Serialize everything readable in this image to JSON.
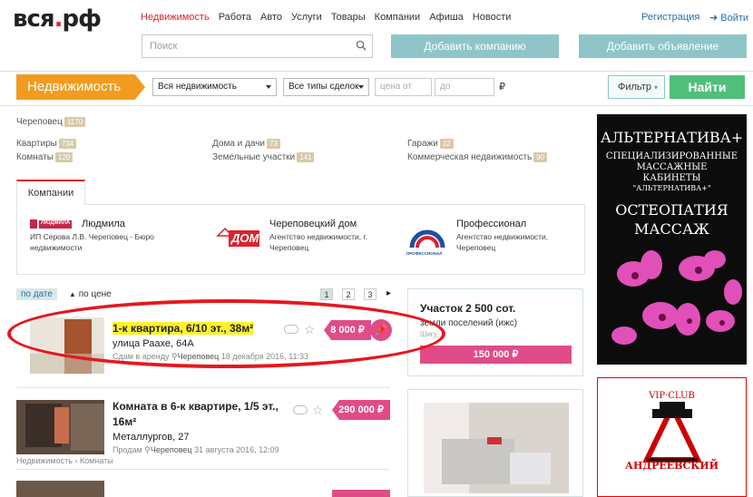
{
  "header": {
    "logo_main": "вся",
    "logo_dot": ".",
    "logo_tail": "рф",
    "nav": [
      "Недвижимость",
      "Работа",
      "Авто",
      "Услуги",
      "Товары",
      "Компании",
      "Афиша",
      "Новости"
    ],
    "register": "Регистрация",
    "login": "Войти",
    "search_placeholder": "Поиск",
    "add_company": "Добавить компанию",
    "add_listing": "Добавить объявление"
  },
  "filter": {
    "section": "Недвижимость",
    "type_select": "Вся недвижимость",
    "deal_select": "Все типы сделок",
    "price_from": "цена от",
    "price_to": "до",
    "currency": "₽",
    "filter_btn": "Фильтр",
    "find_btn": "Найти"
  },
  "city": {
    "name": "Череповец",
    "count": "1170"
  },
  "categories": [
    {
      "label": "Квартиры",
      "count": "734"
    },
    {
      "label": "Комнаты",
      "count": "120"
    },
    {
      "label": "Дома и дачи",
      "count": "73"
    },
    {
      "label": "Земельные участки",
      "count": "141"
    },
    {
      "label": "Гаражи",
      "count": "12"
    },
    {
      "label": "Коммерческая недвижимость",
      "count": "90"
    }
  ],
  "companies": {
    "tab": "Компании",
    "items": [
      {
        "logo_text": "ЛЮДМИЛА",
        "name": "Людмила",
        "desc": "ИП Серова Л.В. Череповец - Бюро недвижимости"
      },
      {
        "logo_text": "ДОМ",
        "name": "Череповецкий дом",
        "desc": "Агентство недвижимости, г. Череповец"
      },
      {
        "logo_text": "ПРОФЕССИОНАЛ",
        "name": "Профессионал",
        "desc": "Агентство недвижимости, Череповец"
      }
    ]
  },
  "sort": {
    "by_date": "по дате",
    "by_price": "по цене",
    "pages": [
      "1",
      "2",
      "3"
    ],
    "next": "▸"
  },
  "listings": [
    {
      "title": "1-к квартира, 6/10 эт., 38м²",
      "address": "улица Раахе, 64А",
      "deal": "Сдам в аренду",
      "city": "Череповец",
      "date": "18 декабря 2016, 11:33",
      "price": "8 000 ₽"
    },
    {
      "title_line1": "Комната в 6-к квартире, 1/5 эт.,",
      "title_line2": "16м²",
      "address": "Металлургов, 27",
      "deal": "Продам",
      "city": "Череповец",
      "date": "31 августа 2016, 12:09",
      "price": "290 000 ₽"
    }
  ],
  "breadcrumb": [
    "Недвижимость",
    "Комнаты"
  ],
  "promo": {
    "title": "Участок 2 500 сот.",
    "subtitle": "земли поселений (ижс)",
    "place": "Шигу",
    "price": "150 000 ₽"
  },
  "ad1": {
    "l1": "АЛЬТЕРНАТИВА+",
    "l2": "СПЕЦИАЛИЗИРОВАННЫЕ",
    "l3": "МАССАЖНЫЕ",
    "l4": "КАБИНЕТЫ",
    "l5": "\"АЛЬТЕРНАТИВА+\"",
    "l6": "ОСТЕОПАТИЯ",
    "l7": "МАССАЖ"
  },
  "ad2": {
    "top": "VIP·CLUB",
    "bottom": "АНДРЕЕВСКИЙ"
  },
  "colors": {
    "brand_red": "#d9232e",
    "orange": "#f39b1f",
    "teal": "#8fc5c8",
    "green": "#4fbf7a",
    "pink": "#e04c88",
    "highlight": "#fff22a"
  }
}
